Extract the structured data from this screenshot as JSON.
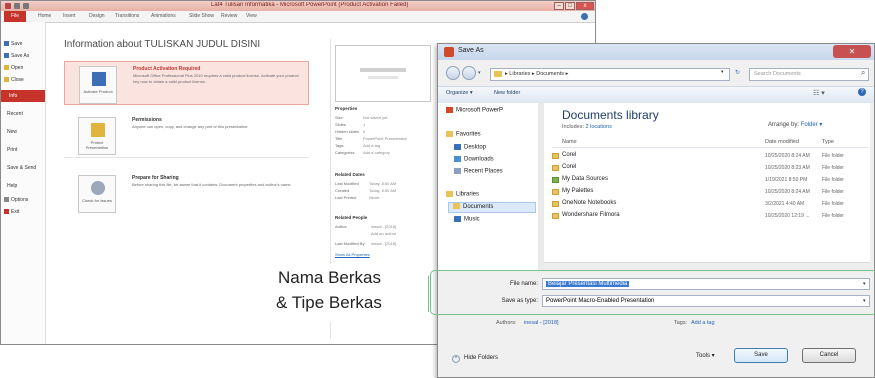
{
  "ppt": {
    "title": "Lat4 Tulisan Informatika - Microsoft PowerPoint (Product Activation Failed)",
    "ribbon_tabs": [
      "File",
      "Home",
      "Insert",
      "Design",
      "Transitions",
      "Animations",
      "Slide Show",
      "Review",
      "View"
    ],
    "sidebar": [
      {
        "label": "Save",
        "icon": "save-icon"
      },
      {
        "label": "Save As",
        "icon": "save-as-icon"
      },
      {
        "label": "Open",
        "icon": "open-folder-icon"
      },
      {
        "label": "Close",
        "icon": "close-document-icon"
      },
      {
        "label": "Info",
        "icon": ""
      },
      {
        "label": "Recent",
        "icon": ""
      },
      {
        "label": "New",
        "icon": ""
      },
      {
        "label": "Print",
        "icon": ""
      },
      {
        "label": "Save & Send",
        "icon": ""
      },
      {
        "label": "Help",
        "icon": ""
      },
      {
        "label": "Options",
        "icon": "options-icon"
      },
      {
        "label": "Exit",
        "icon": "exit-icon"
      }
    ],
    "info_heading": "Information about TULISKAN JUDUL DISINI",
    "cards": [
      {
        "button": "Activate Product",
        "title": "Product Activation Required",
        "desc": "Microsoft Office Professional Plus 2010 requires a valid product license. Activate your product key now to obtain a valid product license."
      },
      {
        "button": "Protect Presentation",
        "title": "Permissions",
        "desc": "Anyone can open, copy, and change any part of this presentation."
      },
      {
        "button": "Check for Issues",
        "title": "Prepare for Sharing",
        "desc": "Before sharing this file, be aware that it contains: Document properties and author's name"
      }
    ],
    "properties_heading": "Properties",
    "properties": [
      {
        "label": "Size",
        "value": "Not saved yet"
      },
      {
        "label": "Slides",
        "value": "1"
      },
      {
        "label": "Hidden slides",
        "value": "0"
      },
      {
        "label": "Title",
        "value": "PowerPoint Presentation"
      },
      {
        "label": "Tags",
        "value": "Add a tag"
      },
      {
        "label": "Categories",
        "value": "Add a category"
      }
    ],
    "related_dates_heading": "Related Dates",
    "related_dates": [
      {
        "label": "Last Modified",
        "value": "Today, 8:50 AM"
      },
      {
        "label": "Created",
        "value": "Today, 8:50 AM"
      },
      {
        "label": "Last Printed",
        "value": "Never"
      }
    ],
    "related_people_heading": "Related People",
    "related_people": [
      {
        "label": "Author",
        "value": "inesal - [2018]"
      },
      {
        "label": "",
        "value": "Add an author"
      },
      {
        "label": "Last Modified By",
        "value": "inesal - [2018]"
      }
    ],
    "show_all_link": "Show All Properties"
  },
  "dialog": {
    "title": "Save As",
    "close_glyph": "✕",
    "breadcrumb": [
      "Libraries",
      "Documents"
    ],
    "search_placeholder": "Search Documents",
    "toolbar": {
      "organize": "Organize ▾",
      "new_folder": "New folder"
    },
    "nav": {
      "top_item": "Microsoft PowerP",
      "favorites": "Favorites",
      "desktop": "Desktop",
      "downloads": "Downloads",
      "recent": "Recent Places",
      "libraries": "Libraries",
      "documents": "Documents",
      "music": "Music"
    },
    "library_title": "Documents library",
    "library_includes": "Includes:",
    "library_locations": "2 locations",
    "arrange_by_label": "Arrange by:",
    "arrange_by_value": "Folder ▾",
    "columns": {
      "name": "Name",
      "date": "Date modified",
      "type": "Type"
    },
    "files": [
      {
        "name": "Corel",
        "date": "10/25/2020 8:24 AM",
        "type": "File folder"
      },
      {
        "name": "Corel",
        "date": "10/25/2020 8:23 AM",
        "type": "File folder"
      },
      {
        "name": "My Data Sources",
        "date": "1/19/2021 8:50 PM",
        "type": "File folder"
      },
      {
        "name": "My Palettes",
        "date": "10/25/2020 8:24 AM",
        "type": "File folder"
      },
      {
        "name": "OneNote Notebooks",
        "date": "3/2/2021 4:40 AM",
        "type": "File folder"
      },
      {
        "name": "Wondershare Filmora",
        "date": "10/25/2020 12:19 ...",
        "type": "File folder"
      }
    ],
    "file_name_label": "File name:",
    "file_name_value": "Belajar Presentasi Multimedia",
    "save_as_type_label": "Save as type:",
    "save_as_type_value": "PowerPoint Macro-Enabled Presentation",
    "authors_label": "Authors:",
    "authors_value": "inesal - [2018]",
    "tags_label": "Tags:",
    "tags_value": "Add a tag",
    "hide_folders": "Hide Folders",
    "tools": "Tools ▾",
    "save": "Save",
    "cancel": "Cancel"
  },
  "annotation": {
    "line1": "Nama Berkas",
    "line2": "& Tipe Berkas",
    "color": "#77c08f"
  }
}
